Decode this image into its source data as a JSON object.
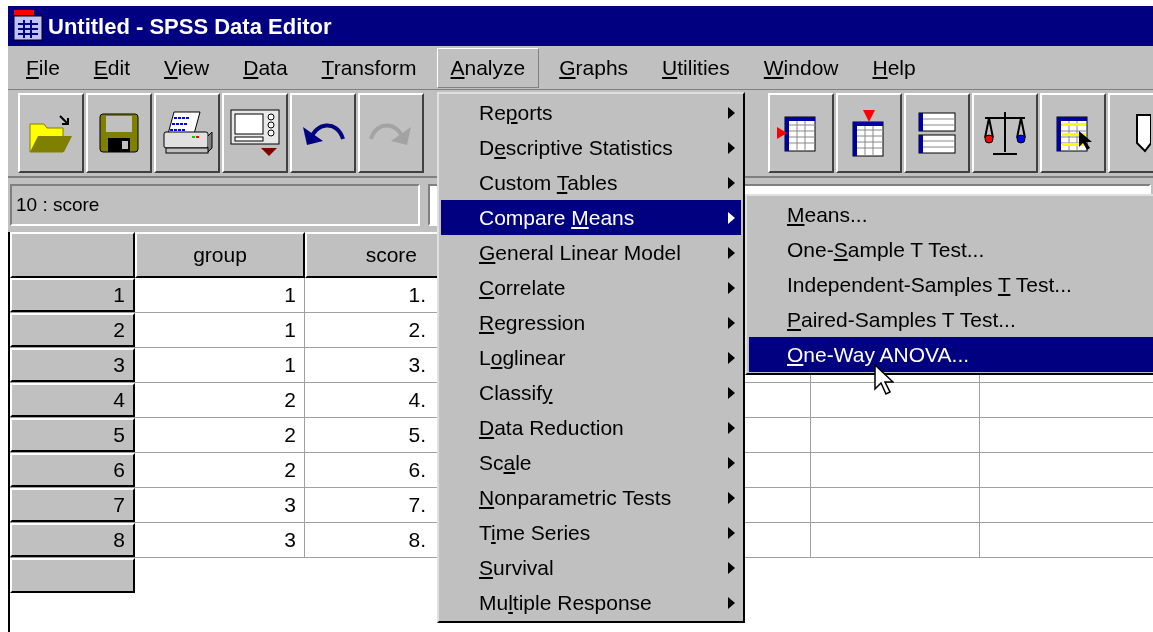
{
  "window": {
    "title": "Untitled - SPSS Data Editor"
  },
  "menu_bar": [
    {
      "label": {
        "key": "F",
        "post": "ile"
      },
      "selected": false
    },
    {
      "label": {
        "key": "E",
        "post": "dit"
      },
      "selected": false
    },
    {
      "label": {
        "key": "V",
        "post": "iew"
      },
      "selected": false
    },
    {
      "label": {
        "key": "D",
        "post": "ata"
      },
      "selected": false
    },
    {
      "label": {
        "key": "T",
        "post": "ransform"
      },
      "selected": false
    },
    {
      "label": {
        "key": "A",
        "post": "nalyze"
      },
      "selected": true
    },
    {
      "label": {
        "key": "G",
        "post": "raphs"
      },
      "selected": false
    },
    {
      "label": {
        "key": "U",
        "post": "tilities"
      },
      "selected": false
    },
    {
      "label": {
        "key": "W",
        "post": "indow"
      },
      "selected": false
    },
    {
      "label": {
        "key": "H",
        "post": "elp"
      },
      "selected": false
    }
  ],
  "toolbar": [
    {
      "kind": "open",
      "disabled": false
    },
    {
      "kind": "save",
      "disabled": false
    },
    {
      "kind": "print",
      "disabled": false
    },
    {
      "kind": "dialog",
      "disabled": false
    },
    {
      "kind": "undo",
      "disabled": false
    },
    {
      "kind": "redo",
      "disabled": true
    },
    {
      "kind": "gap"
    },
    {
      "kind": "insert-case",
      "disabled": false
    },
    {
      "kind": "insert-variable",
      "disabled": false
    },
    {
      "kind": "split",
      "disabled": false
    },
    {
      "kind": "weight",
      "disabled": false
    },
    {
      "kind": "select",
      "disabled": false
    },
    {
      "kind": "labels",
      "disabled": false
    }
  ],
  "cell_editor": {
    "cell": "10 : score"
  },
  "grid": {
    "columns": [
      "group",
      "score"
    ],
    "rows": [
      {
        "case": "1",
        "group": "1",
        "score": "1."
      },
      {
        "case": "2",
        "group": "1",
        "score": "2."
      },
      {
        "case": "3",
        "group": "1",
        "score": "3."
      },
      {
        "case": "4",
        "group": "2",
        "score": "4."
      },
      {
        "case": "5",
        "group": "2",
        "score": "5."
      },
      {
        "case": "6",
        "group": "2",
        "score": "6."
      },
      {
        "case": "7",
        "group": "3",
        "score": "7."
      },
      {
        "case": "8",
        "group": "3",
        "score": "8."
      }
    ]
  },
  "analyze_menu": [
    {
      "label": {
        "pre": "Re",
        "key": "p",
        "post": "orts"
      },
      "selected": false
    },
    {
      "label": {
        "pre": "D",
        "key": "e",
        "post": "scriptive Statistics"
      },
      "selected": false
    },
    {
      "label": {
        "pre": "Custom ",
        "key": "T",
        "post": "ables"
      },
      "selected": false
    },
    {
      "label": {
        "pre": "Compare ",
        "key": "M",
        "post": "eans"
      },
      "selected": true
    },
    {
      "label": {
        "key": "G",
        "post": "eneral Linear Model"
      },
      "selected": false
    },
    {
      "label": {
        "key": "C",
        "post": "orrelate"
      },
      "selected": false
    },
    {
      "label": {
        "key": "R",
        "post": "egression"
      },
      "selected": false
    },
    {
      "label": {
        "pre": "L",
        "key": "o",
        "post": "glinear"
      },
      "selected": false
    },
    {
      "label": {
        "pre": "Classif",
        "key": "y"
      },
      "selected": false
    },
    {
      "label": {
        "key": "D",
        "post": "ata Reduction"
      },
      "selected": false
    },
    {
      "label": {
        "pre": "Sc",
        "key": "a",
        "post": "le"
      },
      "selected": false
    },
    {
      "label": {
        "key": "N",
        "post": "onparametric Tests"
      },
      "selected": false
    },
    {
      "label": {
        "pre": "T",
        "key": "i",
        "post": "me Series"
      },
      "selected": false
    },
    {
      "label": {
        "key": "S",
        "post": "urvival"
      },
      "selected": false
    },
    {
      "label": {
        "pre": "Mu",
        "key": "l",
        "post": "tiple Response"
      },
      "selected": false
    }
  ],
  "compare_means_menu": [
    {
      "label": {
        "key": "M",
        "post": "eans..."
      },
      "selected": false
    },
    {
      "label": {
        "pre": "One-",
        "key": "S",
        "post": "ample T Test..."
      },
      "selected": false
    },
    {
      "label": {
        "pre": "Independent-Samples ",
        "key": "T",
        "post": " Test..."
      },
      "selected": false
    },
    {
      "label": {
        "key": "P",
        "post": "aired-Samples T Test..."
      },
      "selected": false
    },
    {
      "label": {
        "key": "O",
        "post": "ne-Way ANOVA..."
      },
      "selected": true
    }
  ]
}
